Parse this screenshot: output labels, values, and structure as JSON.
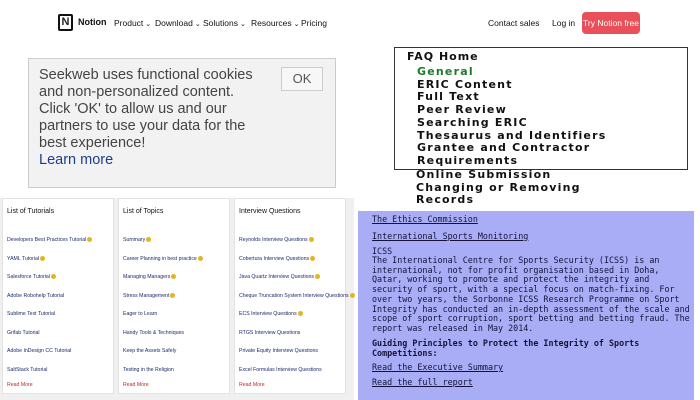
{
  "nav": {
    "logo_letter": "N",
    "brand": "Notion",
    "items": [
      {
        "label": "Product",
        "chev": "⌄"
      },
      {
        "label": "Download",
        "chev": "⌄"
      },
      {
        "label": "Solutions",
        "chev": "⌄"
      },
      {
        "label": "Resources",
        "chev": "⌄"
      },
      {
        "label": "Pricing",
        "chev": ""
      }
    ],
    "contact": "Contact sales",
    "login": "Log in",
    "cta": "Try Notion free",
    "cta_color": "#e9505a"
  },
  "cookie": {
    "text": "Seekweb uses functional cookies and non-personalized content. Click 'OK' to allow us and our partners to use your data for the best experience!",
    "learn_more": "Learn more",
    "ok": "OK"
  },
  "faq": {
    "title": "FAQ Home",
    "items": [
      "General",
      "ERIC Content",
      "Full Text",
      "Peer Review",
      "Searching ERIC",
      "Thesaurus and Identifiers",
      "Grantee and Contractor",
      "Requirements",
      "Online Submission",
      "Changing or Removing",
      "Records"
    ],
    "active_color": "#1e7a2e"
  },
  "lists": {
    "columns": [
      {
        "title": "List of Tutorials",
        "items": [
          {
            "label": "Developers Best Practices Tutorial",
            "badge": true
          },
          {
            "label": "YAML Tutorial",
            "badge": true
          },
          {
            "label": "Salesforce Tutorial",
            "badge": true
          },
          {
            "label": "Adobe Robohelp Tutorial",
            "badge": false
          },
          {
            "label": "Sublime Text Tutorial",
            "badge": false
          },
          {
            "label": "Grifab Tutorial",
            "badge": false
          },
          {
            "label": "Adobe InDesign CC Tutorial",
            "badge": false
          },
          {
            "label": "SaltStack Tutorial",
            "badge": false
          }
        ],
        "more": "Read More"
      },
      {
        "title": "List of Topics",
        "items": [
          {
            "label": "Summary",
            "badge": true
          },
          {
            "label": "Career Planning in best practice",
            "badge": true
          },
          {
            "label": "Managing Managers",
            "badge": true
          },
          {
            "label": "Stress Management",
            "badge": true
          },
          {
            "label": "Eager to Learn",
            "badge": false
          },
          {
            "label": "Handy Tools & Techniques",
            "badge": false
          },
          {
            "label": "Keep the Assets Safely",
            "badge": false
          },
          {
            "label": "Testing in the Religion",
            "badge": false
          }
        ],
        "more": "Read More"
      },
      {
        "title": "Interview Questions",
        "items": [
          {
            "label": "Reynolds Interview Questions",
            "badge": true
          },
          {
            "label": "Cobertura Interview Questions",
            "badge": true
          },
          {
            "label": "Java Quartz Interview Questions",
            "badge": true
          },
          {
            "label": "Cheque Truncation System Interview Questions",
            "badge": true
          },
          {
            "label": "ECS Interview Questions",
            "badge": true
          },
          {
            "label": "RTGS Interview Questions",
            "badge": false
          },
          {
            "label": "Private Equity Interview Questions",
            "badge": false
          },
          {
            "label": "Excel Formulas Interview Questions",
            "badge": false
          }
        ],
        "more": "Read More"
      }
    ]
  },
  "icss": {
    "link1": "The Ethics Commission",
    "link2": "International Sports Monitoring",
    "heading": "ICSS",
    "paragraph": "The International Centre for Sports Security (ICSS) is an international, not for profit organisation based in Doha, Qatar, working to promote and protect the integrity and security of sport, with a special focus on match-fixing. For over two years, the Sorbonne ICSS Research Programme on Sport Integrity has conducted an in-depth assessment of the scale and scope of sport corruption, sport betting and betting fraud. The report was released in May 2014.",
    "guiding": "Guiding Principles to Protect the Integrity of Sports Competitions:",
    "link3": "Read the Executive Summary",
    "link4": "Read the full report",
    "bg_color": "#a9adf5"
  }
}
